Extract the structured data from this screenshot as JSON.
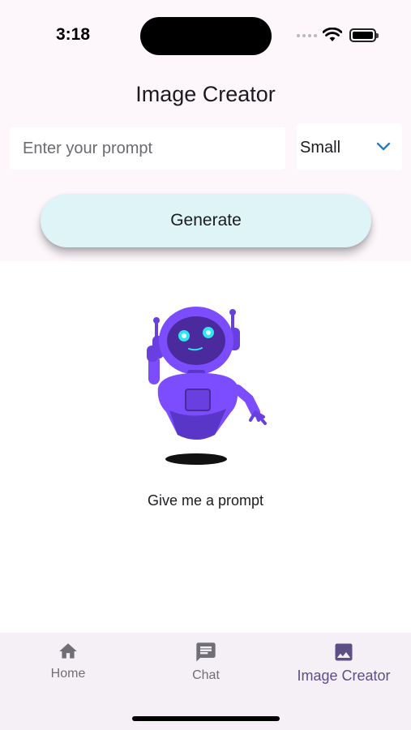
{
  "status_bar": {
    "time": "3:18"
  },
  "header": {
    "title": "Image Creator"
  },
  "form": {
    "prompt_placeholder": "Enter your prompt",
    "prompt_value": "",
    "size_selected": "Small",
    "generate_label": "Generate"
  },
  "empty_state": {
    "message": "Give me a prompt",
    "illustration": "robot-illustration"
  },
  "bottom_nav": {
    "items": [
      {
        "label": "Home",
        "icon": "home-icon"
      },
      {
        "label": "Chat",
        "icon": "chat-icon"
      },
      {
        "label": "Image Creator",
        "icon": "image-icon",
        "active": true
      }
    ]
  },
  "colors": {
    "accent": "#5e4e88",
    "button_bg": "#dff4f6",
    "robot": "#7c4dff",
    "dropdown_chevron": "#2b7bb9"
  }
}
